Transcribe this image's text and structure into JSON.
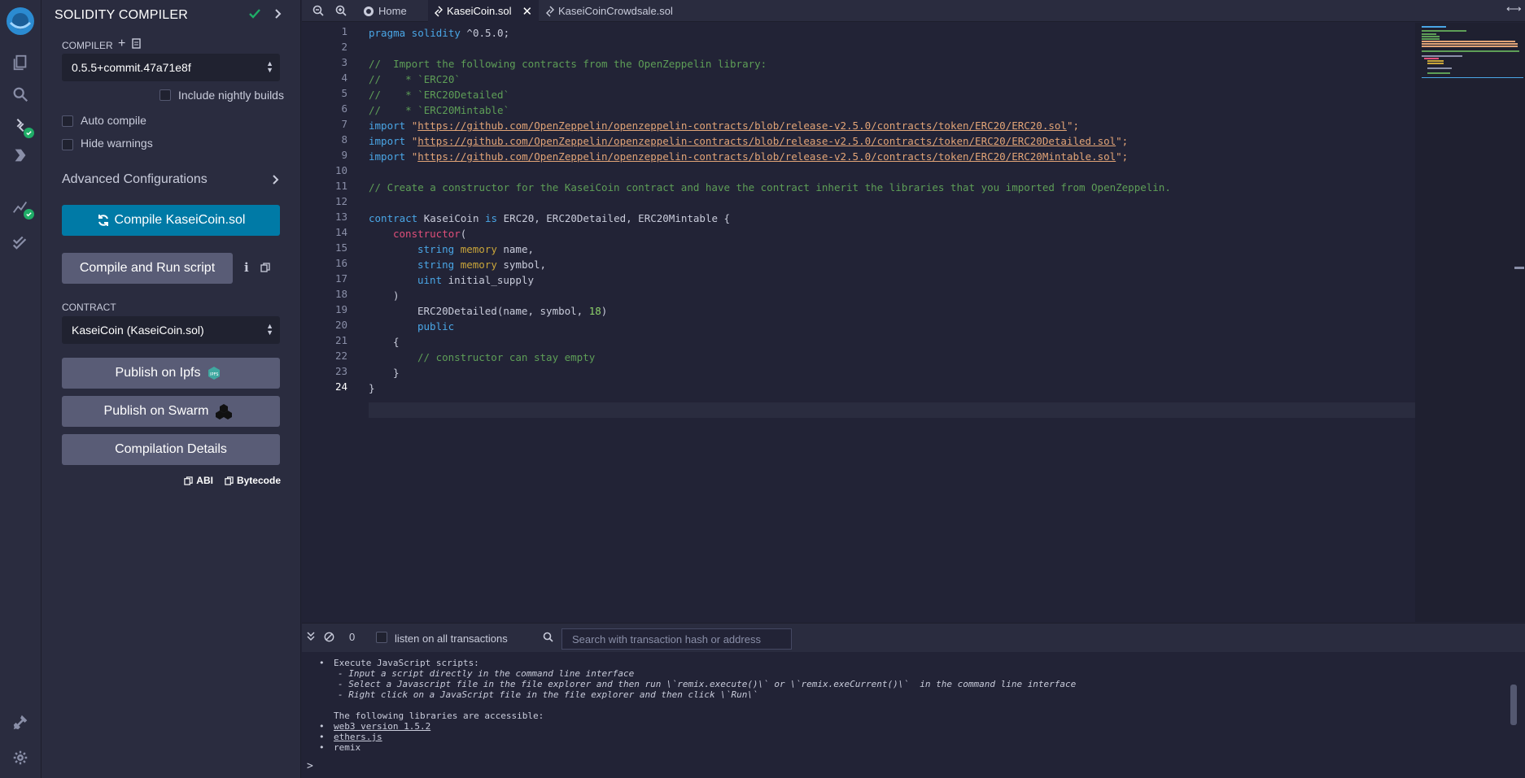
{
  "panel": {
    "title": "SOLIDITY COMPILER",
    "compiler_label": "COMPILER",
    "compiler_version": "0.5.5+commit.47a71e8f",
    "include_nightly": "Include nightly builds",
    "auto_compile": "Auto compile",
    "hide_warnings": "Hide warnings",
    "advanced": "Advanced Configurations",
    "compile_btn": "Compile KaseiCoin.sol",
    "compile_run_btn": "Compile and Run script",
    "contract_label": "CONTRACT",
    "contract_value": "KaseiCoin (KaseiCoin.sol)",
    "publish_ipfs": "Publish on Ipfs",
    "publish_swarm": "Publish on Swarm",
    "compilation_details": "Compilation Details",
    "abi": "ABI",
    "bytecode": "Bytecode"
  },
  "tabs": {
    "home": "Home",
    "active": "KaseiCoin.sol",
    "other": "KaseiCoinCrowdsale.sol"
  },
  "code": {
    "line_numbers": [
      "1",
      "2",
      "3",
      "4",
      "5",
      "6",
      "7",
      "8",
      "9",
      "10",
      "11",
      "12",
      "13",
      "14",
      "15",
      "16",
      "17",
      "18",
      "19",
      "20",
      "21",
      "22",
      "23",
      "24"
    ],
    "l1_kw": "pragma solidity",
    "l1_rest": " ^0.5.0;",
    "l3": "//  Import the following contracts from the OpenZeppelin library:",
    "l4": "//    * `ERC20`",
    "l5": "//    * `ERC20Detailed`",
    "l6": "//    * `ERC20Mintable`",
    "import_kw": "import",
    "q": "\"",
    "end": "\";",
    "url7": "https://github.com/OpenZeppelin/openzeppelin-contracts/blob/release-v2.5.0/contracts/token/ERC20/ERC20.sol",
    "url8": "https://github.com/OpenZeppelin/openzeppelin-contracts/blob/release-v2.5.0/contracts/token/ERC20/ERC20Detailed.sol",
    "url9": "https://github.com/OpenZeppelin/openzeppelin-contracts/blob/release-v2.5.0/contracts/token/ERC20/ERC20Mintable.sol",
    "l11": "// Create a constructor for the KaseiCoin contract and have the contract inherit the libraries that you imported from OpenZeppelin.",
    "l13_kw": "contract",
    "l13_name": " KaseiCoin ",
    "l13_is": "is",
    "l13_rest": " ERC20, ERC20Detailed, ERC20Mintable {",
    "l14_fn": "constructor",
    "l14_rest": "(",
    "string_kw": "string",
    "memory_kw": "memory",
    "l15_rest": " name,",
    "l16_rest": " symbol,",
    "uint_kw": "uint",
    "l17_rest": " initial_supply",
    "l18": ")",
    "l19_a": "ERC20Detailed(name, symbol, ",
    "l19_num": "18",
    "l19_b": ")",
    "l20": "public",
    "l21": "{",
    "l22": "// constructor can stay empty",
    "l23": "}",
    "l24": "}"
  },
  "terminal": {
    "counter": "0",
    "listen": "listen on all transactions",
    "search_placeholder": "Search with transaction hash or address",
    "t1": "Execute JavaScript scripts:",
    "t2": "- Input a script directly in the command line interface",
    "t3": "- Select a Javascript file in the file explorer and then run \\`remix.execute()\\` or \\`remix.exeCurrent()\\`  in the command line interface",
    "t4": "- Right click on a JavaScript file in the file explorer and then click \\`Run\\`",
    "t5": "The following libraries are accessible:",
    "lib1": "web3 version 1.5.2",
    "lib2": "ethers.js",
    "lib3": "remix",
    "prompt": ">"
  },
  "colors": {
    "accent": "#007aa6",
    "success": "#1fad67",
    "background": "#222336"
  }
}
